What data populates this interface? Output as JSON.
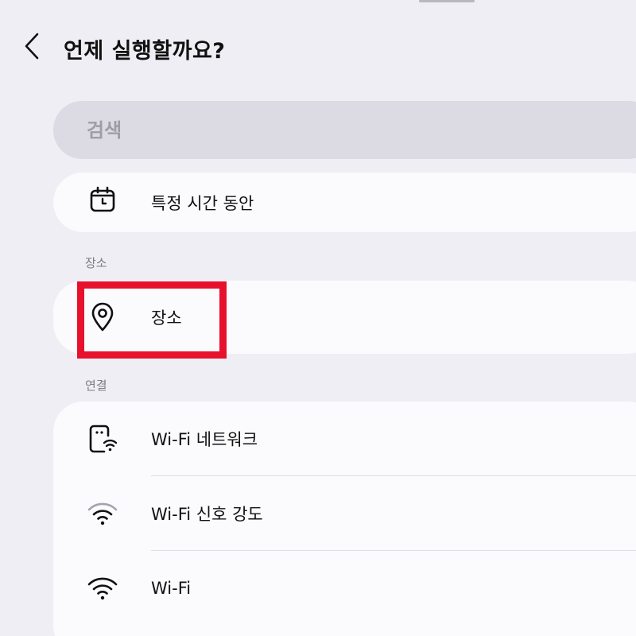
{
  "header": {
    "title": "언제 실행할까요?",
    "back_icon": "chevron-left-icon"
  },
  "search": {
    "placeholder": "검색",
    "value": ""
  },
  "sections": {
    "time": {
      "items": [
        {
          "label": "특정 시간 동안",
          "icon": "calendar-clock-icon"
        }
      ]
    },
    "location": {
      "label": "장소",
      "items": [
        {
          "label": "장소",
          "icon": "location-pin-icon"
        }
      ]
    },
    "connection": {
      "label": "연결",
      "items": [
        {
          "label": "Wi-Fi 네트워크",
          "icon": "phone-wifi-icon"
        },
        {
          "label": "Wi-Fi 신호 강도",
          "icon": "wifi-signal-icon"
        },
        {
          "label": "Wi-Fi",
          "icon": "wifi-icon"
        }
      ]
    }
  },
  "colors": {
    "background": "#efeef5",
    "card": "#fbfbfd",
    "search_bg": "#dcdbe4",
    "highlight": "#e8112d"
  }
}
